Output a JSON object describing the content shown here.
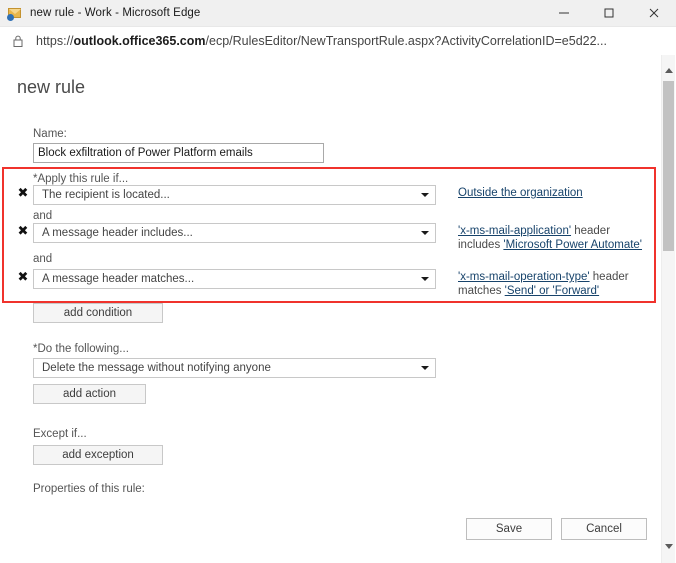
{
  "window": {
    "title": "new rule - Work - Microsoft Edge",
    "icon": "mail-rule-icon",
    "minimize_label": "Minimize",
    "maximize_label": "Maximize",
    "close_label": "Close"
  },
  "address_bar": {
    "lock_icon": "lock-icon",
    "url_prefix": "https://",
    "url_domain": "outlook.office365.com",
    "url_path": "/ecp/RulesEditor/NewTransportRule.aspx?ActivityCorrelationID=e5d22...",
    "url_full": "https://outlook.office365.com/ecp/RulesEditor/NewTransportRule.aspx?ActivityCorrelationID=e5d22..."
  },
  "page": {
    "title": "new rule",
    "name_label": "Name:",
    "name_value": "Block exfiltration of Power Platform emails",
    "name_placeholder": "",
    "apply_label": "*Apply this rule if...",
    "and_label": "and",
    "remove_icon": "remove-condition-icon",
    "dropdown_icon": "chevron-down-icon",
    "conditions": [
      {
        "select_value": "The recipient is located...",
        "value_parts": [
          {
            "text": "Outside the organization",
            "link": true
          }
        ]
      },
      {
        "select_value": "A message header includes...",
        "value_parts": [
          {
            "text": "'x-ms-mail-application'",
            "link": true
          },
          {
            "text": " header includes ",
            "link": false
          },
          {
            "text": "'Microsoft Power Automate'",
            "link": true
          }
        ]
      },
      {
        "select_value": "A message header matches...",
        "value_parts": [
          {
            "text": "'x-ms-mail-operation-type'",
            "link": true
          },
          {
            "text": " header matches ",
            "link": false
          },
          {
            "text": "'Send' or 'Forward'",
            "link": true
          }
        ]
      }
    ],
    "add_condition_label": "add condition",
    "do_following_label": "*Do the following...",
    "action_value": "Delete the message without notifying anyone",
    "add_action_label": "add action",
    "except_if_label": "Except if...",
    "add_exception_label": "add exception",
    "properties_label": "Properties of this rule:",
    "save_label": "Save",
    "cancel_label": "Cancel"
  },
  "scrollbar": {
    "up_icon": "scroll-up-icon",
    "down_icon": "scroll-down-icon",
    "thumb": "scroll-thumb"
  },
  "colors": {
    "highlight_box": "#f0322c",
    "link": "#17436b",
    "title_bar": "#f0f0f0"
  }
}
